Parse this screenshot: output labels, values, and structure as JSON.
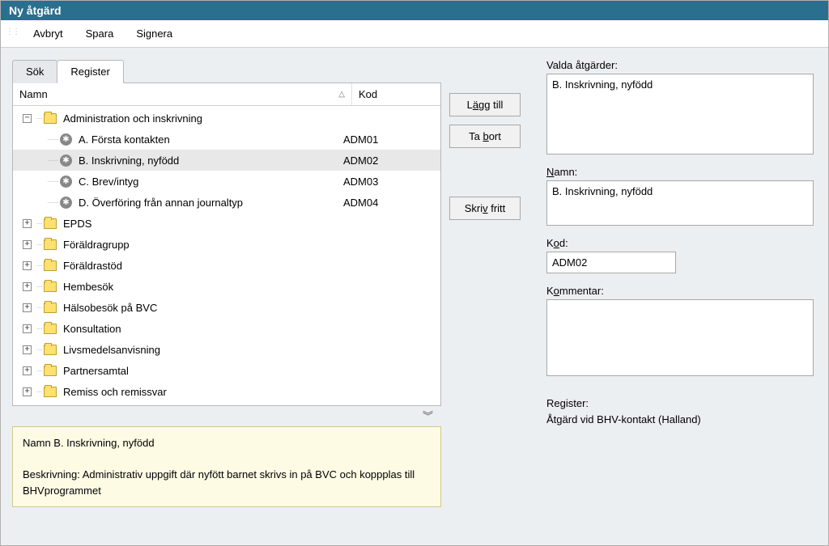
{
  "window": {
    "title": "Ny åtgärd"
  },
  "menu": {
    "avbryt": "Avbryt",
    "spara": "Spara",
    "signera": "Signera"
  },
  "tabs": {
    "sok": "Sök",
    "register": "Register"
  },
  "tree": {
    "header_name": "Namn",
    "header_kod": "Kod",
    "items": [
      {
        "type": "folder",
        "label": "Administration och inskrivning",
        "expanded": true,
        "level": 0
      },
      {
        "type": "leaf",
        "label": "A. Första kontakten",
        "kod": "ADM01",
        "level": 1
      },
      {
        "type": "leaf",
        "label": "B. Inskrivning, nyfödd",
        "kod": "ADM02",
        "level": 1,
        "selected": true
      },
      {
        "type": "leaf",
        "label": "C. Brev/intyg",
        "kod": "ADM03",
        "level": 1
      },
      {
        "type": "leaf",
        "label": "D. Överföring från annan journaltyp",
        "kod": "ADM04",
        "level": 1
      },
      {
        "type": "folder",
        "label": "EPDS",
        "expanded": false,
        "level": 0
      },
      {
        "type": "folder",
        "label": "Föräldragrupp",
        "expanded": false,
        "level": 0
      },
      {
        "type": "folder",
        "label": "Föräldrastöd",
        "expanded": false,
        "level": 0
      },
      {
        "type": "folder",
        "label": "Hembesök",
        "expanded": false,
        "level": 0
      },
      {
        "type": "folder",
        "label": "Hälsobesök på BVC",
        "expanded": false,
        "level": 0
      },
      {
        "type": "folder",
        "label": "Konsultation",
        "expanded": false,
        "level": 0
      },
      {
        "type": "folder",
        "label": "Livsmedelsanvisning",
        "expanded": false,
        "level": 0
      },
      {
        "type": "folder",
        "label": "Partnersamtal",
        "expanded": false,
        "level": 0
      },
      {
        "type": "folder",
        "label": "Remiss och remissvar",
        "expanded": false,
        "level": 0
      }
    ]
  },
  "description": {
    "name_line": "Namn B. Inskrivning, nyfödd",
    "desc_line": "Beskrivning: Administrativ uppgift där nyfött barnet skrivs in på BVC och koppplas till BHVprogrammet"
  },
  "buttons": {
    "lagg_till_pre": "L",
    "lagg_till_u": "ä",
    "lagg_till_post": "gg till",
    "ta_bort_pre": "Ta ",
    "ta_bort_u": "b",
    "ta_bort_post": "ort",
    "skriv_fritt_pre": "Skri",
    "skriv_fritt_u": "v",
    "skriv_fritt_post": " fritt"
  },
  "right": {
    "valda_atgarder_label": "Valda åtgärder:",
    "valda_atgarder_value": "B. Inskrivning, nyfödd",
    "namn_label_pre": "",
    "namn_label_u": "N",
    "namn_label_post": "amn:",
    "namn_value": "B. Inskrivning, nyfödd",
    "kod_label_pre": "K",
    "kod_label_u": "o",
    "kod_label_post": "d:",
    "kod_value": "ADM02",
    "kommentar_label_pre": "K",
    "kommentar_label_u": "o",
    "kommentar_label_post": "mmentar:",
    "kommentar_value": "",
    "register_label": "Register:",
    "register_value": "Åtgärd vid BHV-kontakt (Halland)"
  }
}
